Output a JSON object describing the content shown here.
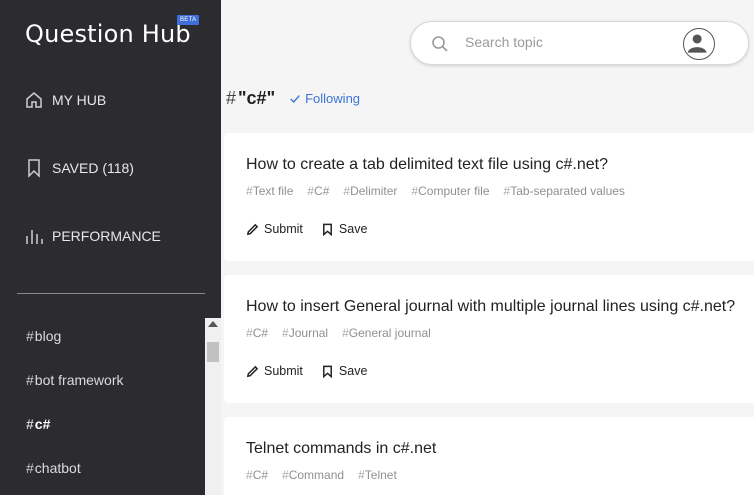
{
  "app": {
    "title": "Question Hub",
    "badge": "BETA"
  },
  "nav": [
    {
      "label": "MY HUB",
      "icon": "home-icon"
    },
    {
      "label": "SAVED (118)",
      "icon": "bookmark-icon"
    },
    {
      "label": "PERFORMANCE",
      "icon": "bar-chart-icon"
    }
  ],
  "sidebar_tags": [
    {
      "label": "blog",
      "active": false
    },
    {
      "label": "bot framework",
      "active": false
    },
    {
      "label": "c#",
      "active": true
    },
    {
      "label": "chatbot",
      "active": false
    }
  ],
  "search": {
    "placeholder": "Search topic"
  },
  "topic": {
    "hash": "#",
    "title": "\"c#\"",
    "following_label": "Following"
  },
  "questions": [
    {
      "title": "How to create a tab delimited text file using c#.net?",
      "tags": [
        "Text file",
        "C#",
        "Delimiter",
        "Computer file",
        "Tab-separated values"
      ],
      "submit_label": "Submit",
      "save_label": "Save"
    },
    {
      "title": "How to insert General journal with multiple journal lines using c#.net?",
      "tags": [
        "C#",
        "Journal",
        "General journal"
      ],
      "submit_label": "Submit",
      "save_label": "Save"
    },
    {
      "title": "Telnet commands in c#.net",
      "tags": [
        "C#",
        "Command",
        "Telnet"
      ]
    }
  ],
  "colors": {
    "sidebar_bg": "#2b2b30",
    "accent": "#3a74d8",
    "badge": "#3f6fd8"
  }
}
